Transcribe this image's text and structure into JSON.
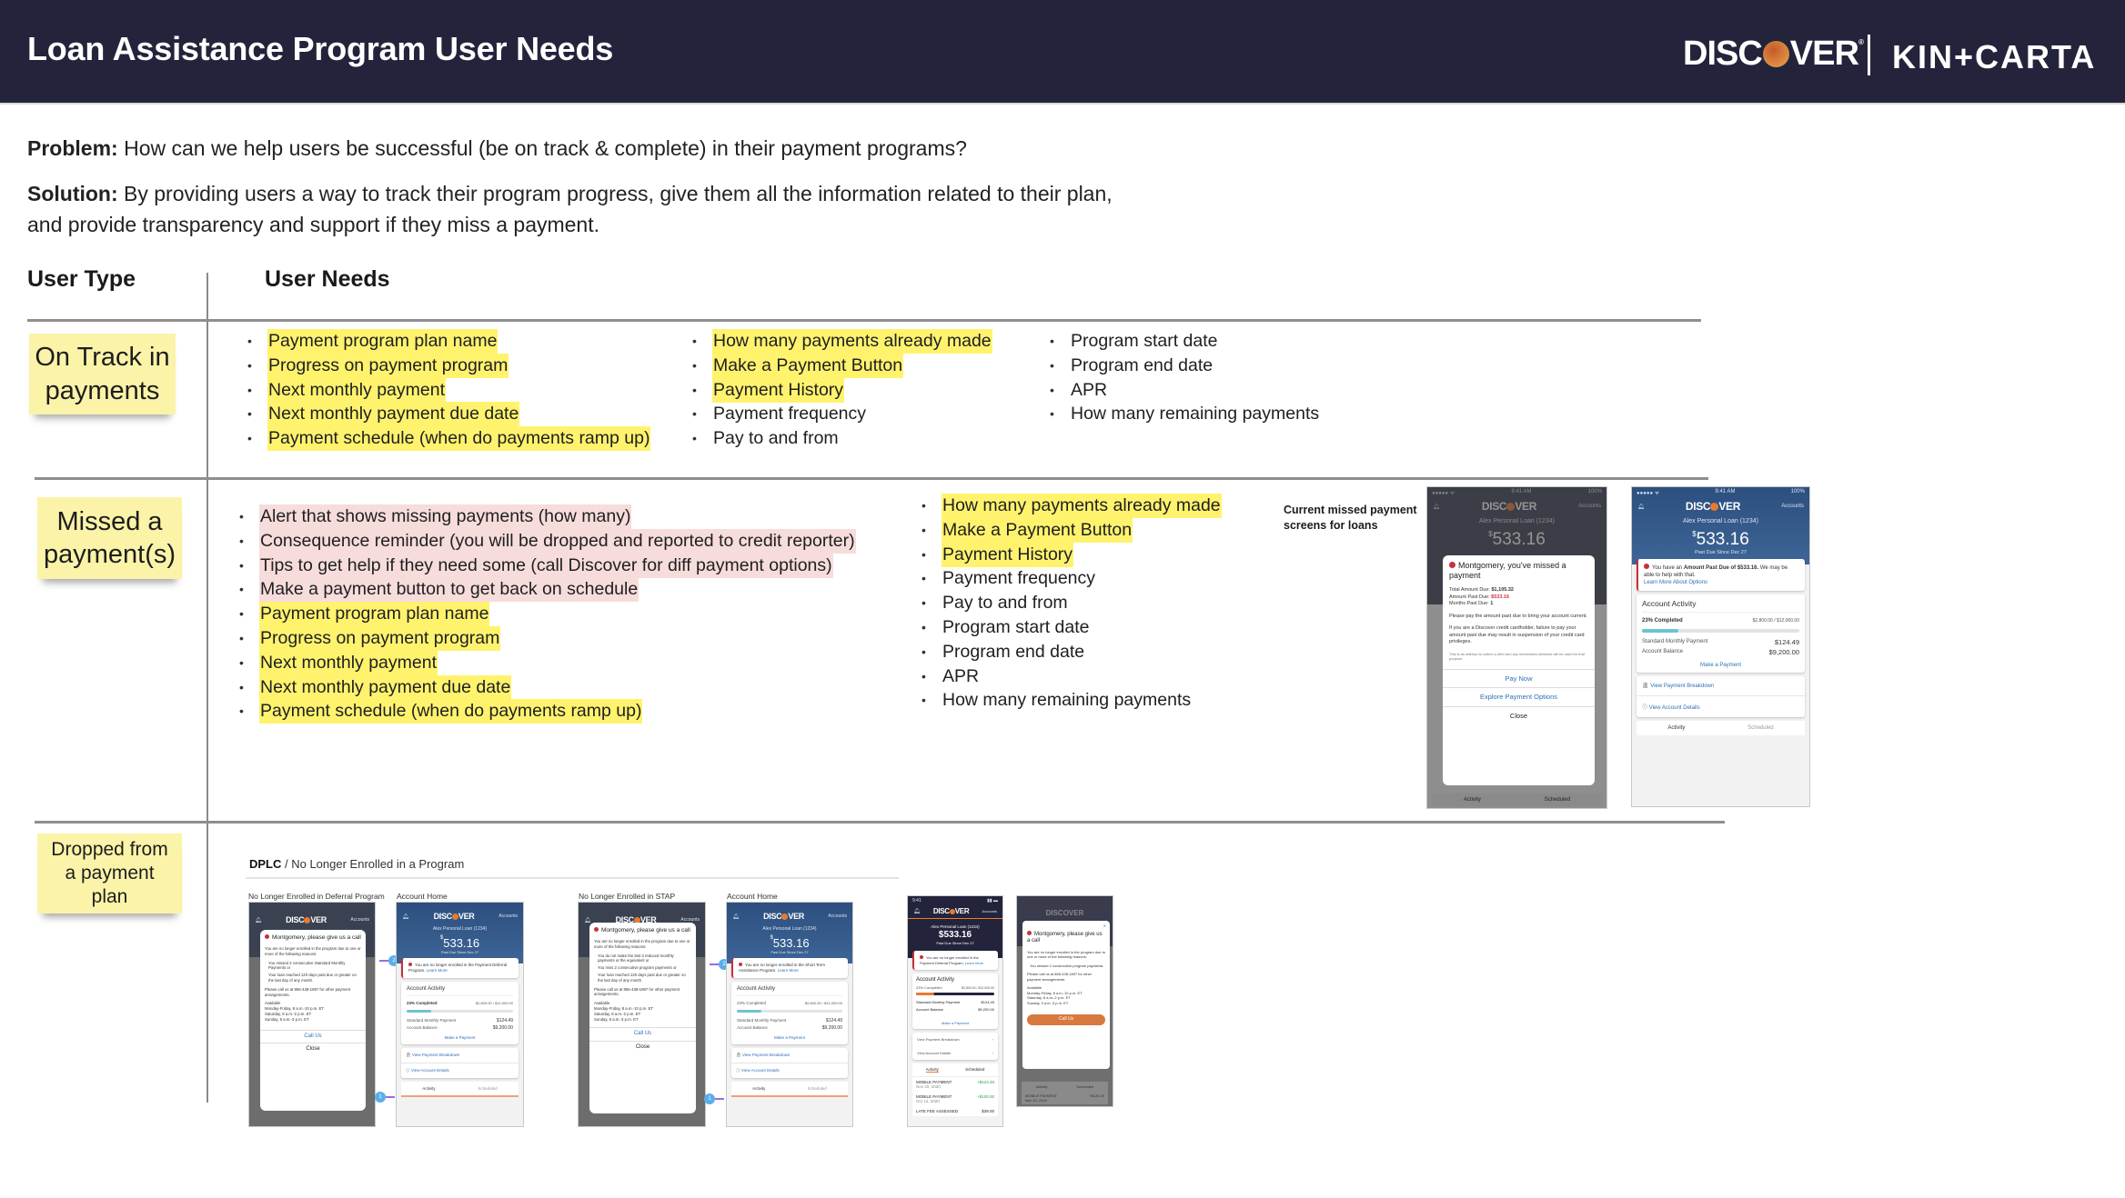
{
  "header": {
    "title": "Loan Assistance Program User Needs",
    "logos": {
      "discover_prefix": "DISC",
      "discover_suffix": "VER",
      "kincarta": "KIN+CARTA"
    },
    "background_color": "#23243c"
  },
  "problem": {
    "label": "Problem:",
    "text": " How can we help users be successful (be on track & complete) in their payment programs?"
  },
  "solution": {
    "label": "Solution:",
    "text": " By providing users a way to track their program progress, give them all the information related to their plan, and provide transparency and support if they miss a payment."
  },
  "columns": {
    "user_type": "User Type",
    "user_needs": "User Needs"
  },
  "highlight_colors": {
    "yellow": "#fff36e",
    "pink": "#f7dcdc",
    "sticky": "#fbf3a8"
  },
  "rows": {
    "on_track": {
      "label": "On Track in payments",
      "col1": [
        {
          "text": "Payment program plan name",
          "hl": "yellow"
        },
        {
          "text": "Progress on payment program",
          "hl": "yellow"
        },
        {
          "text": "Next monthly payment",
          "hl": "yellow"
        },
        {
          "text": "Next monthly payment due date",
          "hl": "yellow"
        },
        {
          "text": "Payment schedule (when do payments ramp up)",
          "hl": "yellow"
        }
      ],
      "col2": [
        {
          "text": "How many payments already made",
          "hl": "yellow"
        },
        {
          "text": "Make a Payment Button",
          "hl": "yellow"
        },
        {
          "text": "Payment History",
          "hl": "yellow"
        },
        {
          "text": "Payment frequency",
          "hl": ""
        },
        {
          "text": "Pay to and from",
          "hl": ""
        }
      ],
      "col3": [
        {
          "text": "Program start date",
          "hl": ""
        },
        {
          "text": "Program end date",
          "hl": ""
        },
        {
          "text": "APR",
          "hl": ""
        },
        {
          "text": "How many remaining payments",
          "hl": ""
        }
      ]
    },
    "missed": {
      "label": "Missed a payment(s)",
      "col1": [
        {
          "text": "Alert that shows missing payments (how many)",
          "hl": "pink"
        },
        {
          "text": "Consequence reminder (you will be dropped and reported to credit reporter)",
          "hl": "pink"
        },
        {
          "text": "Tips to get help if they need some (call Discover for diff payment options)",
          "hl": "pink"
        },
        {
          "text": "Make a payment button to get back on schedule",
          "hl": "pink"
        },
        {
          "text": "Payment program plan name",
          "hl": "yellow"
        },
        {
          "text": "Progress on payment program",
          "hl": "yellow"
        },
        {
          "text": "Next monthly payment",
          "hl": "yellow"
        },
        {
          "text": "Next monthly payment due date",
          "hl": "yellow"
        },
        {
          "text": "Payment schedule (when do payments ramp up)",
          "hl": "yellow"
        }
      ],
      "col2": [
        {
          "text": "How many payments already made",
          "hl": "yellow"
        },
        {
          "text": "Make a Payment Button",
          "hl": "yellow"
        },
        {
          "text": "Payment History",
          "hl": "yellow"
        },
        {
          "text": "Payment frequency",
          "hl": ""
        },
        {
          "text": "Pay to and from",
          "hl": ""
        },
        {
          "text": "Program start date",
          "hl": ""
        },
        {
          "text": "Program end date",
          "hl": ""
        },
        {
          "text": "APR",
          "hl": ""
        },
        {
          "text": "How many remaining payments",
          "hl": ""
        }
      ],
      "screens_caption": "Current missed payment screens for loans",
      "modal_phone": {
        "time": "9:41 AM",
        "battery": "100%",
        "accounts": "Accounts",
        "account_name": "Alex Personal Loan (1234)",
        "amount": "533.16",
        "modal_title": "Montgomery, you've missed a payment",
        "total_due_label": "Total Amount Due:",
        "total_due": "$1,105.32",
        "past_due_label": "Amount Past Due:",
        "past_due": "$533.16",
        "months_label": "Months Past Due:",
        "months": "1",
        "body1": "Please pay the amount past due to bring your account current.",
        "body2": "If you are a Discover credit cardholder, failure to pay your amount past due may result in suspension of your credit card privileges.",
        "fineprint": "This is an attempt to collect a debt and any information obtained will be used for that purpose.",
        "btn_pay": "Pay Now",
        "btn_explore": "Explore Payment Options",
        "btn_close": "Close",
        "tab_activity": "Activity",
        "tab_scheduled": "Scheduled"
      },
      "home_phone": {
        "time": "9:41 AM",
        "battery": "100%",
        "accounts": "Accounts",
        "account_name": "Alex Personal Loan (1234)",
        "amount": "533.16",
        "since": "Past Due Since Dec 27",
        "alert_pre": "You have an ",
        "alert_bold": "Amount Past Due of $533.16.",
        "alert_post": " We may be able to help with that.",
        "alert_link": "Learn More About Options",
        "activity_title": "Account Activity",
        "completed": "23% Completed",
        "completed_fraction": 0.23,
        "paid_total": "$2,800.00 / $12,000.00",
        "monthly_label": "Standard Monthly Payment",
        "monthly": "$124.49",
        "balance_label": "Account Balance",
        "balance": "$9,200.00",
        "make_payment": "Make a Payment",
        "breakdown": "View Payment Breakdown",
        "details": "View Account Details",
        "tab_activity": "Activity",
        "tab_scheduled": "Scheduled"
      }
    },
    "dropped": {
      "label": "Dropped from a payment plan",
      "dplc_bold": "DPLC",
      "dplc_rest": " / No Longer Enrolled in a Program",
      "captions": [
        "No Longer Enrolled in Deferral Program",
        "Account Home",
        "No Longer Enrolled in STAP",
        "Account Home"
      ],
      "deferral_modal": {
        "title": "Montgomery, please give us a call",
        "intro": "You are no longer enrolled in the program due to one or more of the following reasons:",
        "reasons": [
          "You missed 2 consecutive Standard Monthly Payments or",
          "Your loan reached 120 days past due or greater on the last day of any month."
        ],
        "call": "Please call us at 866-438-1897 for other payment arrangements.",
        "hours": [
          "Available",
          "Monday-Friday, 8 a.m.-10 p.m. ET",
          "Saturday, 8 a.m.-2 p.m. ET",
          "Sunday, 9 a.m.-3 p.m. ET"
        ],
        "btn_call": "Call Us",
        "btn_close": "Close"
      },
      "stap_modal": {
        "title": "Montgomery, please give us a call",
        "intro": "You are no longer enrolled in the program due to one or more of the following reasons:",
        "reasons": [
          "You do not make the last 3 reduced monthly payments or the equivalent or",
          "You miss 2 consecutive program payments or",
          "Your loan reached 120 days past due or greater on the last day of any month"
        ],
        "call": "Please call us at 866-438-1897 for other payment arrangements.",
        "hours": [
          "Available",
          "Monday-Friday, 8 a.m.-10 p.m. ET",
          "Saturday, 8 a.m.-2 p.m. ET",
          "Sunday, 9 a.m.-3 p.m. ET"
        ],
        "btn_call": "Call Us",
        "btn_close": "Close"
      },
      "home_deferral_alert": "You are no longer enrolled in the Payment Deferral Program.",
      "home_stap_alert": "You are no longer enrolled in the Short Term Assistance Program.",
      "learn_more": "Learn More",
      "callouts": [
        "1",
        "2"
      ],
      "new_home": {
        "time": "9:41",
        "account_name": "Alex Personal Loan (1234)",
        "amount": "$533.16",
        "since": "Past Due Since Dec 27",
        "alert": "You are no longer enrolled in the Payment Deferral Program.",
        "rows": [
          {
            "title": "MOBILE PAYMENT",
            "date": "Nov 20, 2020",
            "amount": "+$124.49"
          },
          {
            "title": "MOBILE PAYMENT",
            "date": "Oct 14, 2020",
            "amount": "+$100.00"
          },
          {
            "title": "LATE FEE ASSESSED",
            "date": "",
            "amount": "$39.00"
          }
        ]
      },
      "new_modal": {
        "title": "Montgomery, please give us a call",
        "intro": "You are no longer enrolled in the program due to one or more of the following reasons:",
        "reason": "You missed 2 consecutive program payments",
        "call": "Please call us at 866-438-1897 for other payment arrangements.",
        "btn_call": "Call Us",
        "row": {
          "title": "MOBILE PAYMENT",
          "date": "Nov 20, 2020",
          "amount": "+$124.49"
        }
      }
    }
  }
}
